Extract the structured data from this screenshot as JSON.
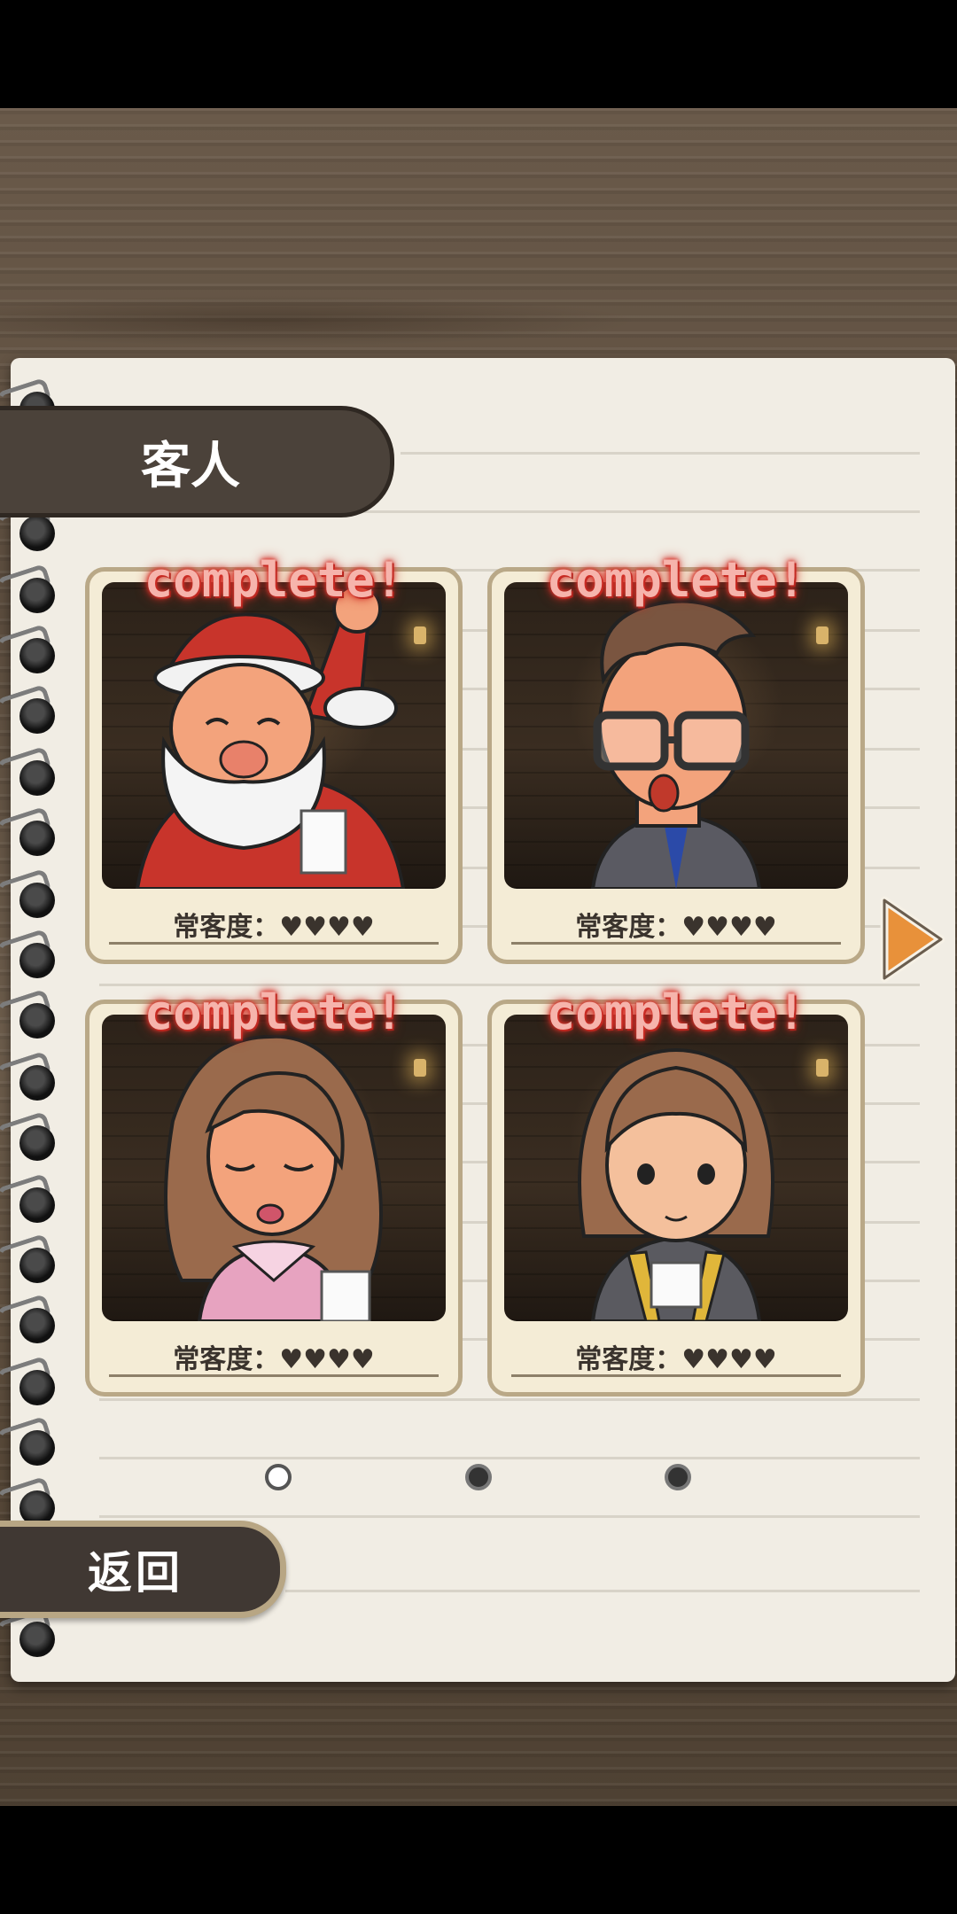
{
  "header": {
    "title": "客人"
  },
  "cards": [
    {
      "status": "complete!",
      "label": "常客度：♥♥♥♥",
      "character": "santa"
    },
    {
      "status": "complete!",
      "label": "常客度：♥♥♥♥",
      "character": "glasses-man"
    },
    {
      "status": "complete!",
      "label": "常客度：♥♥♥♥",
      "character": "woman-wavy-hair"
    },
    {
      "status": "complete!",
      "label": "常客度：♥♥♥♥",
      "character": "woman-bob-hair"
    }
  ],
  "pagination": {
    "current": 1,
    "total": 3
  },
  "footer": {
    "back_label": "返回"
  },
  "icons": {
    "next": "arrow-right-icon"
  },
  "colors": {
    "complete_glow": "#d8322a",
    "next_arrow": "#e8913a"
  }
}
